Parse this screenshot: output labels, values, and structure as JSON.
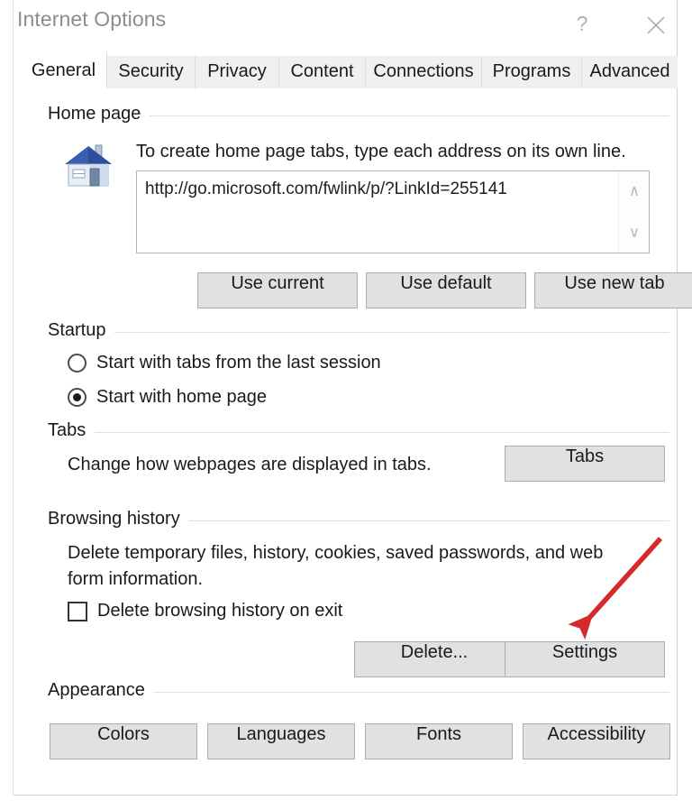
{
  "window": {
    "title": "Internet Options",
    "help_label": "?",
    "close_label": "✕"
  },
  "tabs": [
    {
      "label": "General",
      "selected": true
    },
    {
      "label": "Security",
      "selected": false
    },
    {
      "label": "Privacy",
      "selected": false
    },
    {
      "label": "Content",
      "selected": false
    },
    {
      "label": "Connections",
      "selected": false
    },
    {
      "label": "Programs",
      "selected": false
    },
    {
      "label": "Advanced",
      "selected": false
    }
  ],
  "home_page": {
    "group_title": "Home page",
    "icon": "house-icon",
    "description": "To create home page tabs, type each address on its own line.",
    "url_value": "http://go.microsoft.com/fwlink/p/?LinkId=255141",
    "scroll_up": "∧",
    "scroll_down": "∨",
    "buttons": [
      {
        "label": "Use current"
      },
      {
        "label": "Use default"
      },
      {
        "label": "Use new tab"
      }
    ]
  },
  "startup": {
    "group_title": "Startup",
    "options": [
      {
        "label": "Start with tabs from the last session",
        "selected": false
      },
      {
        "label": "Start with home page",
        "selected": true
      }
    ]
  },
  "tabs_section": {
    "group_title": "Tabs",
    "description": "Change how webpages are displayed in tabs.",
    "button_label": "Tabs"
  },
  "browsing_history": {
    "group_title": "Browsing history",
    "description_line1": "Delete temporary files, history, cookies, saved passwords, and web",
    "description_line2": "form information.",
    "checkbox_label": "Delete browsing history on exit",
    "checkbox_checked": false,
    "buttons": [
      {
        "label": "Delete..."
      },
      {
        "label": "Settings"
      }
    ]
  },
  "appearance": {
    "group_title": "Appearance",
    "buttons": [
      {
        "label": "Colors"
      },
      {
        "label": "Languages"
      },
      {
        "label": "Fonts"
      },
      {
        "label": "Accessibility"
      }
    ]
  },
  "annotation": {
    "type": "arrow",
    "color": "#D42A2A",
    "points_to": "Settings"
  },
  "colors": {
    "title_text": "#8d8d8d",
    "button_face": "#e1e1e1",
    "button_border": "#adadad",
    "tab_strip": "#f0f0f0",
    "annotation_red": "#D42A2A"
  }
}
